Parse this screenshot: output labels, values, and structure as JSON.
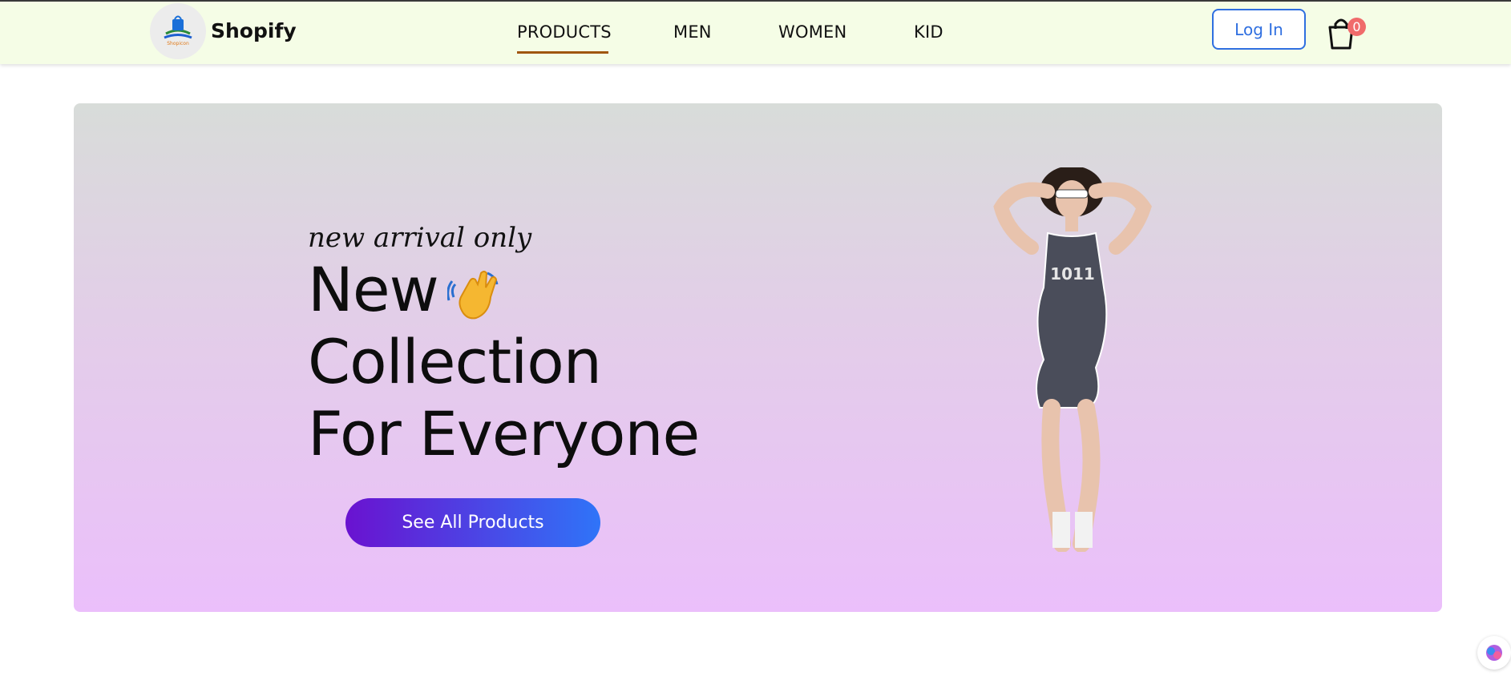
{
  "brand": {
    "name": "Shopify",
    "logo_text": "Shopicon"
  },
  "nav": {
    "links": [
      {
        "label": "PRODUCTS",
        "active": true
      },
      {
        "label": "MEN",
        "active": false
      },
      {
        "label": "WOMEN",
        "active": false
      },
      {
        "label": "KID",
        "active": false
      }
    ]
  },
  "header": {
    "login_label": "Log In",
    "cart_count": "0"
  },
  "hero": {
    "subtitle": "new arrival only",
    "line1": "New",
    "line2": "Collection",
    "line3": "For Everyone",
    "cta_label": "See All Products",
    "model_shirt_text": "1011"
  },
  "colors": {
    "nav_bg": "#f5fde6",
    "accent_underline": "#a0560e",
    "login_blue": "#2f6fe0",
    "badge": "#f06b6b",
    "cta_start": "#6a12d0",
    "cta_end": "#2f74f8"
  },
  "icons": [
    "logo-icon",
    "shopping-bag-icon",
    "waving-hand-icon",
    "assistant-icon"
  ]
}
